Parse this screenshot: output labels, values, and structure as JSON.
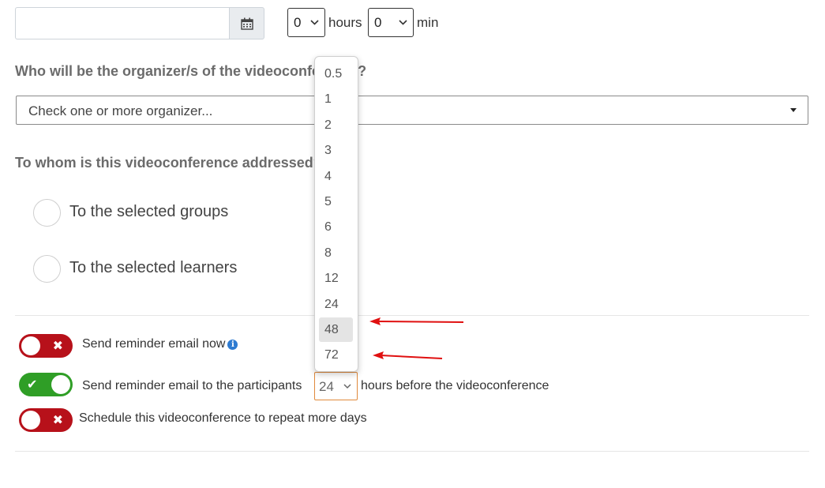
{
  "duration": {
    "hours_value": "0",
    "hours_label": "hours",
    "min_value": "0",
    "min_label": "min"
  },
  "organizer": {
    "question": "Who will be the organizer/s of the videoconference?",
    "placeholder": "Check one or more organizer..."
  },
  "audience": {
    "question": "To whom is this videoconference addressed?",
    "options": [
      "To the selected groups",
      "To the selected learners"
    ]
  },
  "reminders": {
    "now_label": "Send reminder email now",
    "now_enabled": false,
    "participants_prefix": "Send reminder email to the participants",
    "participants_hours": "24",
    "participants_suffix": "hours before the videoconference",
    "participants_enabled": true,
    "repeat_label": "Schedule this videoconference to repeat more days",
    "repeat_enabled": false
  },
  "hours_dropdown": {
    "options": [
      "0.5",
      "1",
      "2",
      "3",
      "4",
      "5",
      "6",
      "8",
      "12",
      "24",
      "48",
      "72"
    ],
    "highlighted": "48"
  },
  "icons": {
    "calendar": "calendar-icon",
    "info": "info-icon",
    "toggle_off": "x-icon",
    "toggle_on": "check-icon"
  },
  "colors": {
    "toggle_off": "#b7111a",
    "toggle_on": "#2f9e26",
    "annotation_arrow": "#e01010",
    "focus_border": "#e08a3c"
  }
}
